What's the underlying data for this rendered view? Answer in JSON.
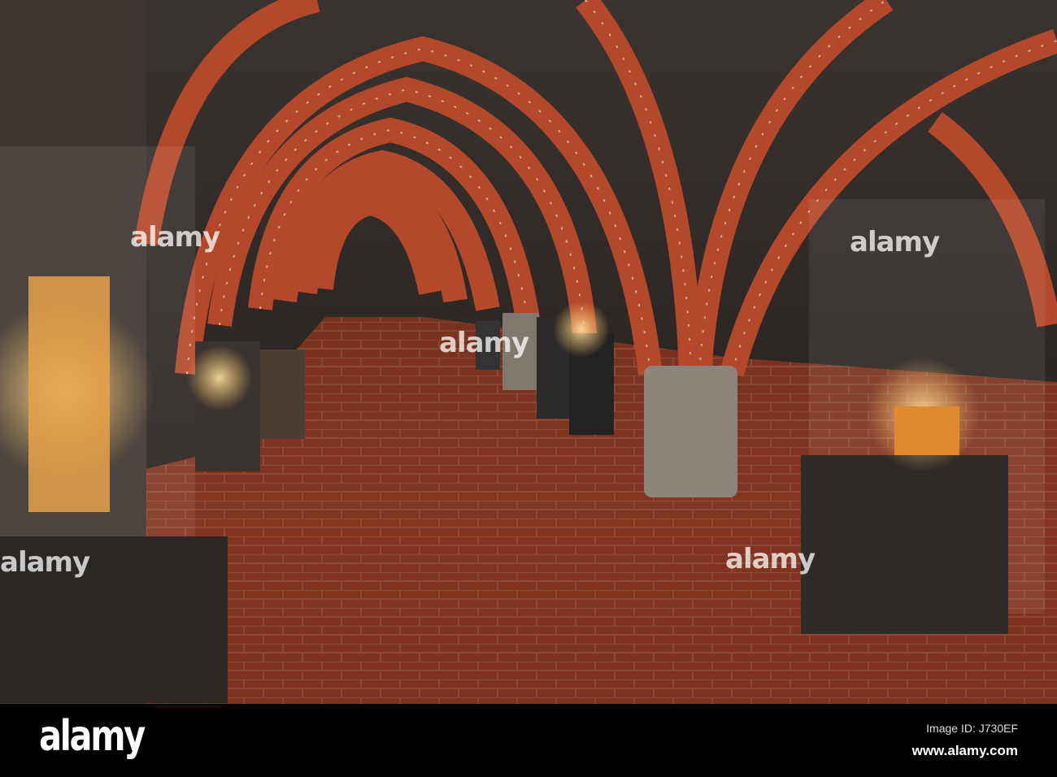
{
  "photo": {
    "subject": "brick-vaulted museum gallery",
    "palette": {
      "brick": "#b4482a",
      "floor": "#7a2f1d",
      "vault": "#2a2622",
      "pillar": "#8c857c",
      "glow": "#f6c56a"
    }
  },
  "watermark": {
    "text": "alamy"
  },
  "footer": {
    "logo": "alamy",
    "image_id": "Image ID: J730EF",
    "website": "www.alamy.com"
  }
}
